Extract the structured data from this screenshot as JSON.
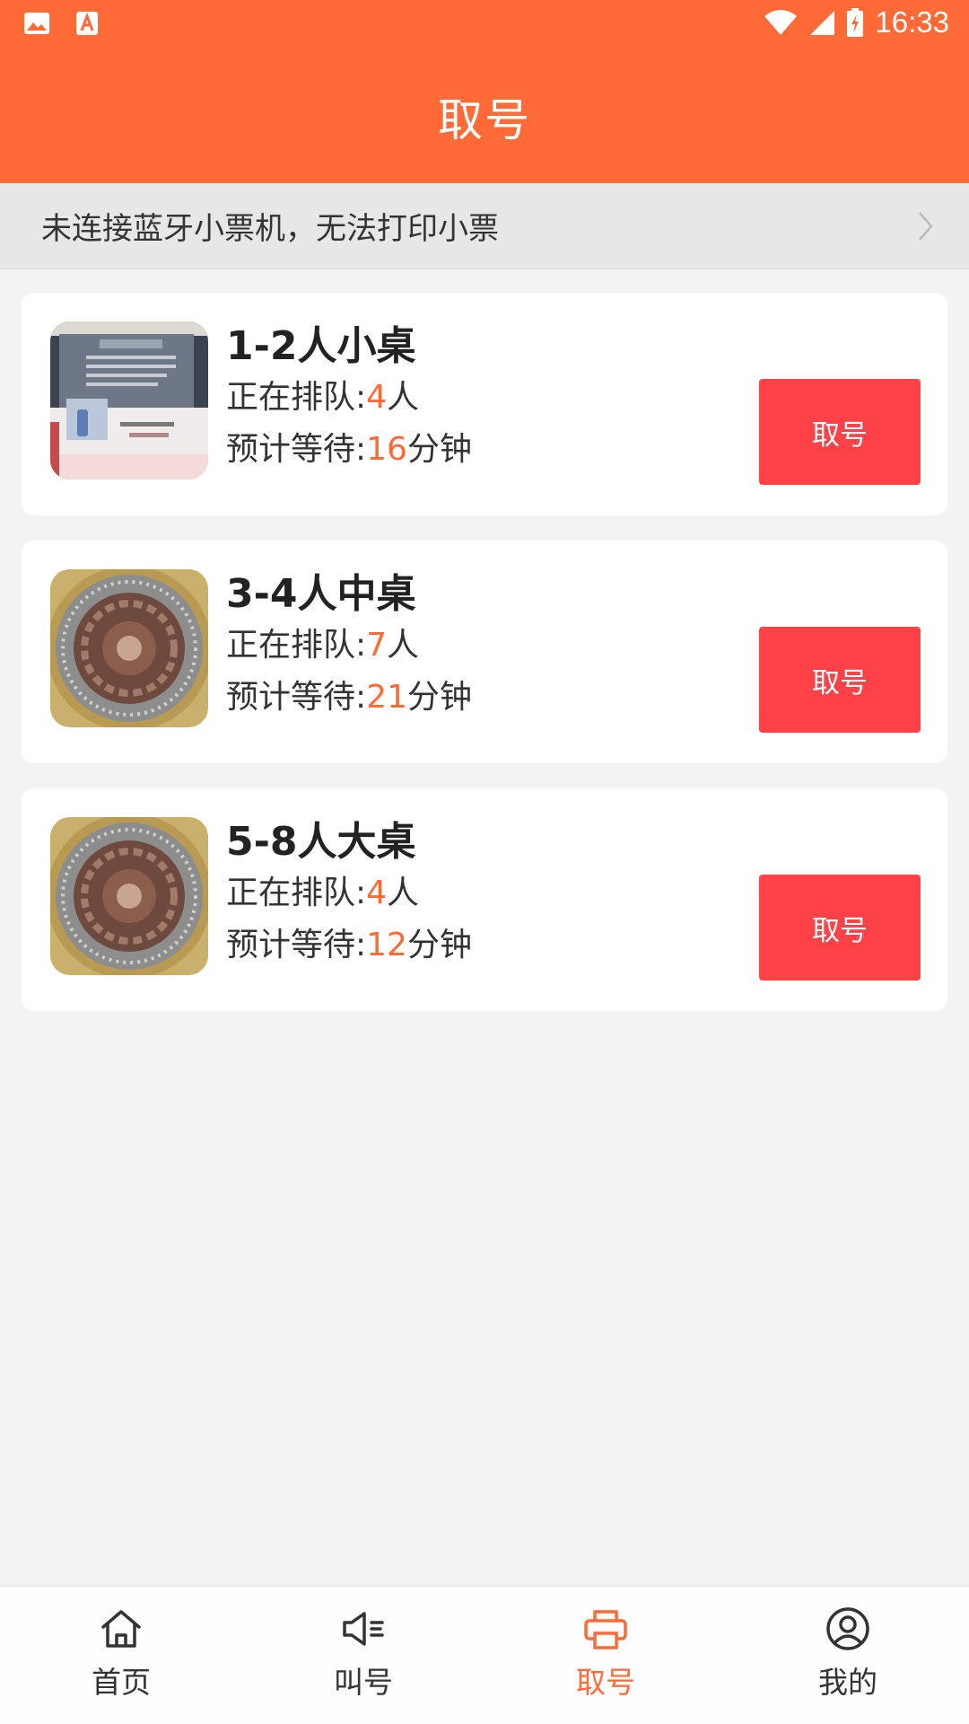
{
  "status_bar": {
    "time": "16:33",
    "icons": [
      "image-icon",
      "font-download-icon",
      "wifi-icon",
      "signal-icon",
      "battery-charging-icon"
    ]
  },
  "header": {
    "title": "取号"
  },
  "banner": {
    "text": "未连接蓝牙小票机，无法打印小票"
  },
  "queue_label": "正在排队:",
  "wait_label": "预计等待:",
  "people_unit": "人",
  "minute_unit": "分钟",
  "tables": [
    {
      "name": "1-2人小桌",
      "queue": "4",
      "wait": "16",
      "button": "取号",
      "image": "store-display-photo"
    },
    {
      "name": "3-4人中桌",
      "queue": "7",
      "wait": "21",
      "button": "取号",
      "image": "grilled-meat-photo"
    },
    {
      "name": "5-8人大桌",
      "queue": "4",
      "wait": "12",
      "button": "取号",
      "image": "grilled-meat-photo"
    }
  ],
  "tabs": [
    {
      "label": "首页",
      "icon": "home-icon"
    },
    {
      "label": "叫号",
      "icon": "speaker-icon"
    },
    {
      "label": "取号",
      "icon": "printer-icon",
      "active": true
    },
    {
      "label": "我的",
      "icon": "user-icon"
    }
  ],
  "colors": {
    "primary": "#ff6a36",
    "button": "#ff4148",
    "background": "#f4f3f3"
  }
}
